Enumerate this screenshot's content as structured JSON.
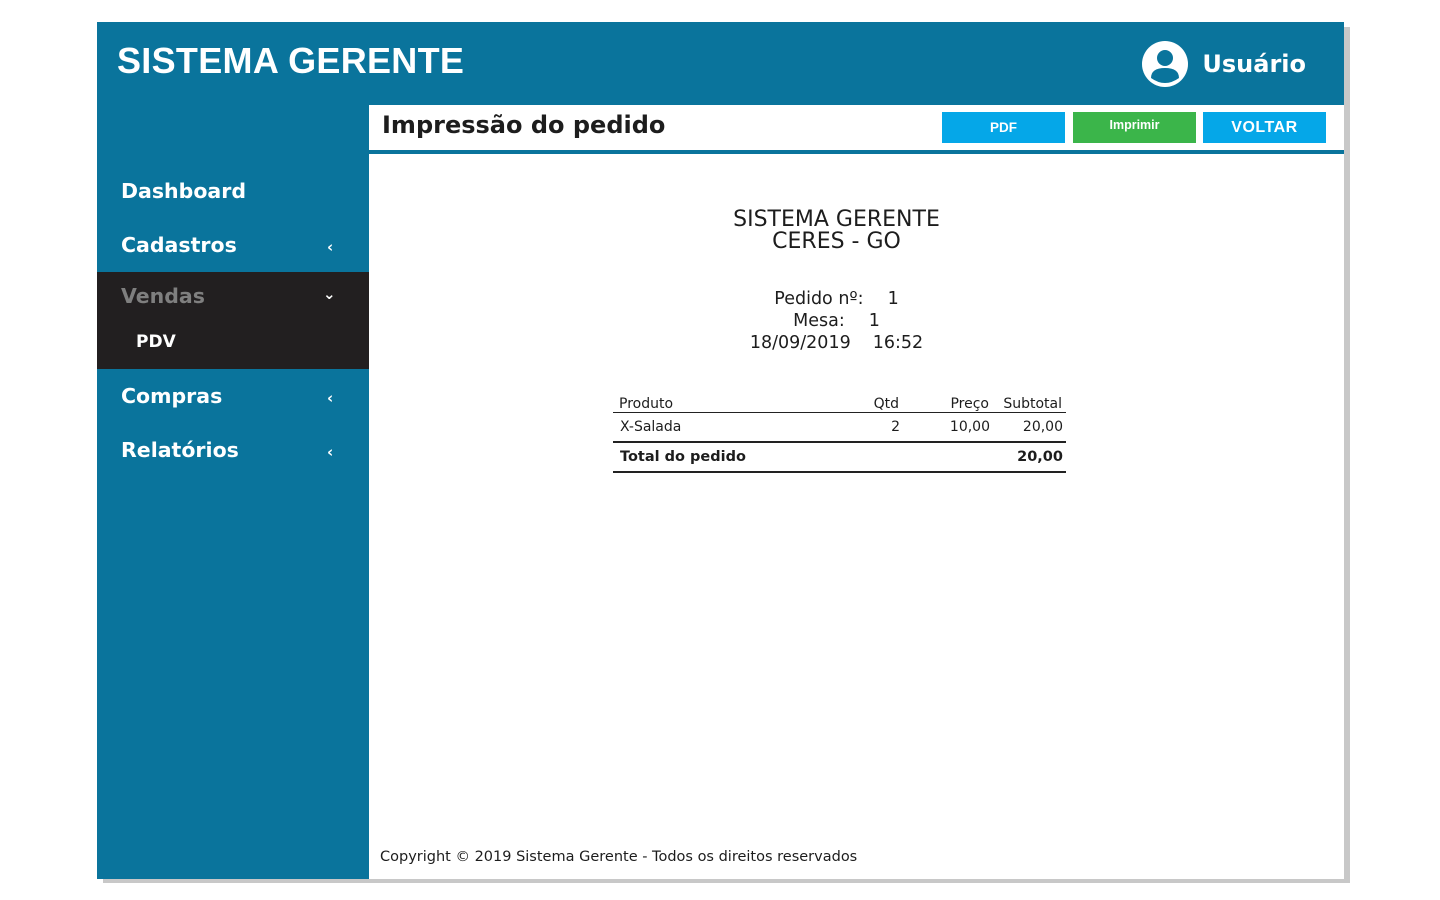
{
  "app": {
    "brand": "SISTEMA GERENTE",
    "user_name": "Usuário"
  },
  "sidebar": {
    "items": [
      {
        "label": "Dashboard",
        "chevron": ""
      },
      {
        "label": "Cadastros",
        "chevron": "‹"
      },
      {
        "label": "Vendas",
        "chevron": "⌄",
        "expanded": true,
        "sub": [
          {
            "label": "PDV"
          }
        ]
      },
      {
        "label": "Compras",
        "chevron": "‹"
      },
      {
        "label": "Relatórios",
        "chevron": "‹"
      }
    ]
  },
  "page": {
    "title": "Impressão do pedido",
    "buttons": {
      "pdf": "PDF",
      "print": "Imprimir",
      "back": "VOLTAR"
    }
  },
  "receipt": {
    "company": "SISTEMA GERENTE",
    "location": "CERES - GO",
    "order_label": "Pedido nº:",
    "order_number": "1",
    "table_label": "Mesa:",
    "table_number": "1",
    "date": "18/09/2019",
    "time": "16:52",
    "columns": {
      "product": "Produto",
      "qty": "Qtd",
      "price": "Preço",
      "subtotal": "Subtotal"
    },
    "items": [
      {
        "product": "X-Salada",
        "qty": "2",
        "price": "10,00",
        "subtotal": "20,00"
      }
    ],
    "total_label": "Total do pedido",
    "total_value": "20,00"
  },
  "footer": {
    "copyright": "Copyright © 2019 Sistema Gerente - Todos os direitos reservados"
  },
  "colors": {
    "primary": "#0a749c",
    "button_blue": "#05a7e8",
    "button_green": "#3bb54a",
    "sidebar_active": "#221f20"
  }
}
